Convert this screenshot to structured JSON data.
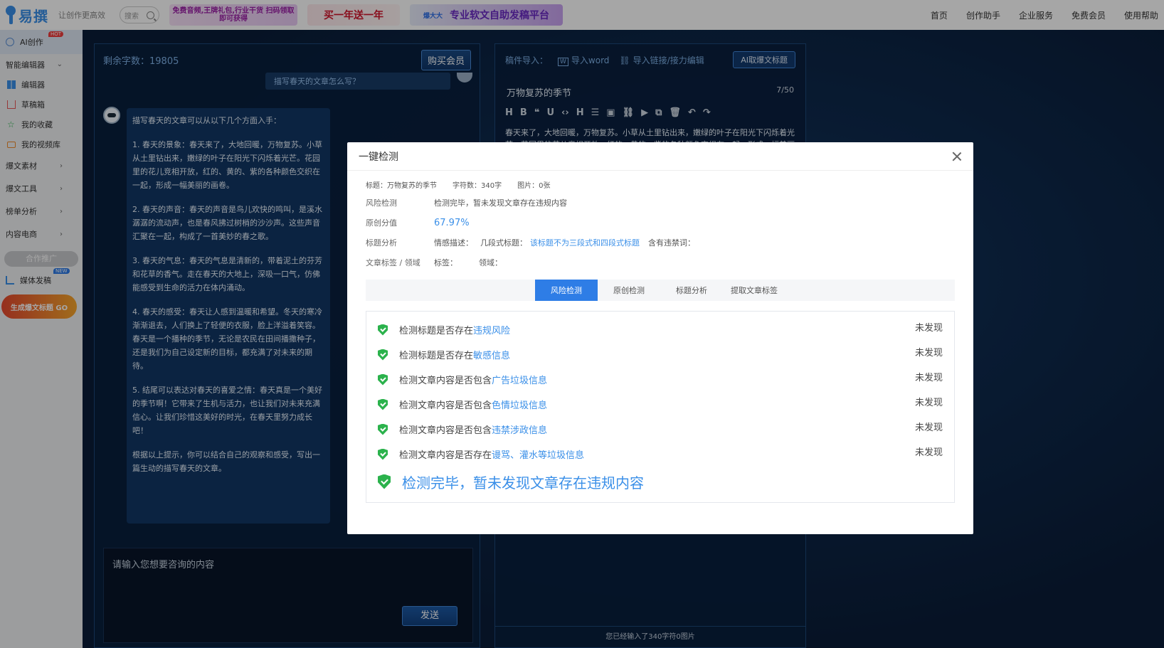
{
  "header": {
    "logo": "易撰",
    "slogan": "让创作更高效",
    "search_placeholder": "搜索",
    "banner1": "免费音频,王牌礼包,行业干货 扫码领取即可获得",
    "banner2": "买一年送一年",
    "banner3_tag": "爆大大",
    "banner3": "专业软文自助发稿平台",
    "nav": [
      "首页",
      "创作助手",
      "企业服务",
      "免费会员",
      "使用帮助"
    ]
  },
  "sidebar": {
    "ai_create": "AI创作",
    "hot": "HOT",
    "smart_editor": "智能编辑器",
    "editor": "编辑器",
    "drafts": "草稿箱",
    "favorites": "我的收藏",
    "videos": "我的视频库",
    "materials": "爆文素材",
    "tools": "爆文工具",
    "ranking": "榜单分析",
    "ecommerce": "内容电商",
    "coop": "合作推广",
    "media": "媒体发稿",
    "new": "NEW",
    "gen_title": "生成爆文标题 GO"
  },
  "chat": {
    "remaining": "剩余字数：19805",
    "buy_vip": "购买会员",
    "prev_question": "描写春天的文章怎么写？",
    "answer": [
      "描写春天的文章可以从以下几个方面入手：",
      "1. 春天的景象：春天来了，大地回暖，万物复苏。小草从土里钻出来，嫩绿的叶子在阳光下闪烁着光芒。花园里的花儿竞相开放，红的、黄的、紫的各种颜色交织在一起，形成一幅美丽的画卷。",
      "2. 春天的声音：春天的声音是鸟儿欢快的鸣叫，是溪水潺潺的流动声，也是春风拂过树梢的沙沙声。这些声音汇聚在一起，构成了一首美妙的春之歌。",
      "3. 春天的气息：春天的气息是清新的，带着泥土的芬芳和花草的香气。走在春天的大地上，深吸一口气，仿佛能感受到生命的活力在体内涌动。",
      "4. 春天的感受：春天让人感到温暖和希望。冬天的寒冷渐渐退去，人们换上了轻便的衣服，脸上洋溢着笑容。春天是一个播种的季节，无论是农民在田间播撒种子，还是我们为自己设定新的目标，都充满了对未来的期待。",
      "5. 结尾可以表达对春天的喜爱之情：春天真是一个美好的季节啊！它带来了生机与活力，也让我们对未来充满信心。让我们珍惜这美好的时光，在春天里努力成长吧！",
      "根据以上提示，你可以结合自己的观察和感受，写出一篇生动的描写春天的文章。"
    ],
    "input_placeholder": "请输入您想要咨询的内容",
    "send": "发送"
  },
  "editor": {
    "import_label": "稿件导入：",
    "import_word": "导入word",
    "import_link": "导入链接/接力编辑",
    "ai_title": "AI取爆文标题",
    "title": "万物复苏的季节",
    "title_count": "7/50",
    "toolbar": [
      "H",
      "B",
      "❝",
      "U",
      "‹›",
      "H",
      "☰",
      "▣",
      "⛓",
      "▶",
      "⧉",
      "🗑",
      "↶",
      "↷"
    ],
    "body": "春天来了，大地回暖，万物复苏。小草从土里钻出来，嫩绿的叶子在阳光下闪烁着光芒，花园里的花儿竞相开放，红的、黄的、紫的各种颜色交织在一起，形成一幅美丽",
    "footer": "您已经输入了340字符0图片"
  },
  "modal": {
    "title": "一键检测",
    "meta_title": "标题：万物复苏的季节",
    "meta_chars": "字符数：340字",
    "meta_images": "图片：0张",
    "risk_label": "风险检测",
    "risk_value": "检测完毕，暂未发现文章存在违规内容",
    "orig_label": "原创分值",
    "orig_value": "67.97%",
    "title_label": "标题分析",
    "emotion": "情感描述：",
    "segment": "几段式标题：",
    "segment_value": "该标题不为三段式和四段式标题",
    "forbidden": "含有违禁词：",
    "tags_label": "文章标签 / 领域",
    "tags": "标签：",
    "field": "领域：",
    "tabs": [
      "风险检测",
      "原创检测",
      "标题分析",
      "提取文章标签"
    ],
    "checks": [
      {
        "pre": "检测标题是否存在",
        "link": "违规风险",
        "result": "未发现"
      },
      {
        "pre": "检测标题是否存在",
        "link": "敏感信息",
        "result": "未发现"
      },
      {
        "pre": "检测文章内容是否包含",
        "link": "广告垃圾信息",
        "result": "未发现"
      },
      {
        "pre": "检测文章内容是否包含",
        "link": "色情垃圾信息",
        "result": "未发现"
      },
      {
        "pre": "检测文章内容是否包含",
        "link": "违禁涉政信息",
        "result": "未发现"
      },
      {
        "pre": "检测文章内容是否存在",
        "link": "谩骂、灌水等垃圾信息",
        "result": "未发现"
      }
    ],
    "final": "检测完毕，暂未发现文章存在违规内容"
  }
}
